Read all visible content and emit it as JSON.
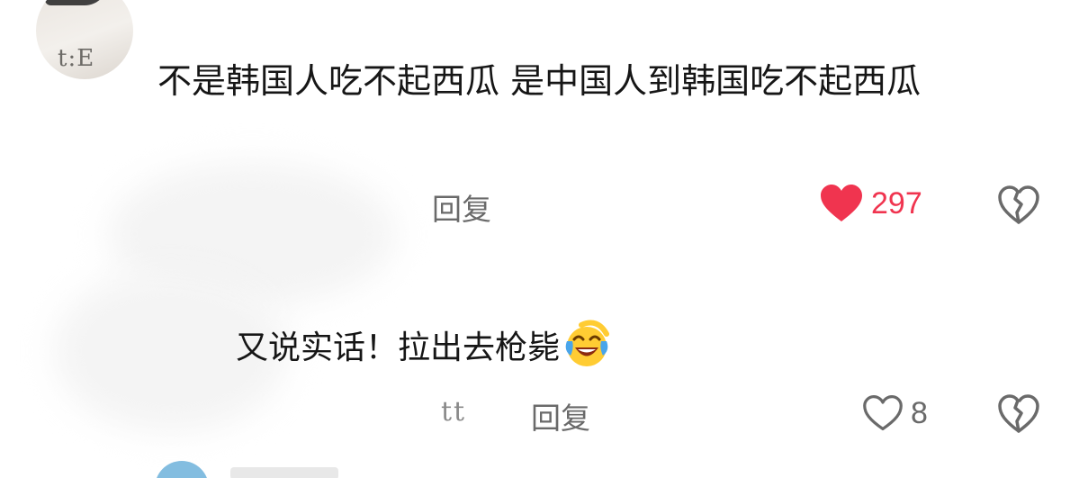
{
  "comment": {
    "avatar_text": "t:E",
    "text": "不是韩国人吃不起西瓜 是中国人到韩国吃不起西瓜",
    "reply_label": "回复",
    "likes": "297",
    "liked": true
  },
  "reply": {
    "text": "又说实话！拉出去枪毙",
    "emoji": "face-with-tears-of-joy",
    "author_badge": "tt",
    "reply_label": "回复",
    "likes": "8",
    "liked": false
  },
  "colors": {
    "like_active": "#f0344f",
    "icon_gray": "#6a6a6a",
    "text": "#161616"
  }
}
